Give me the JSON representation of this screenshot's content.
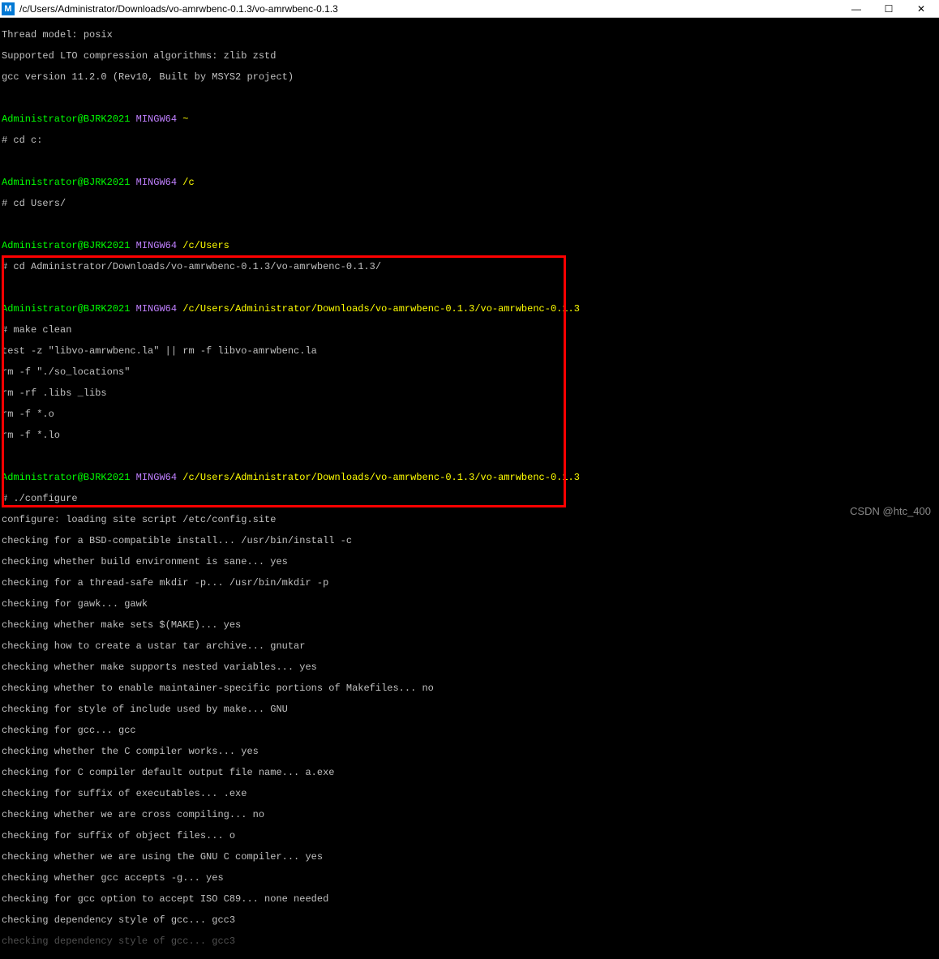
{
  "titlebar": {
    "icon_letter": "M",
    "path": "/c/Users/Administrator/Downloads/vo-amrwbenc-0.1.3/vo-amrwbenc-0.1.3",
    "min": "—",
    "max": "☐",
    "close": "✕"
  },
  "lines": {
    "l1": "Thread model: posix",
    "l2": "Supported LTO compression algorithms: zlib zstd",
    "l3": "gcc version 11.2.0 (Rev10, Built by MSYS2 project)",
    "l4": "",
    "p1_user": "Administrator@BJRK2021",
    "p1_env": "MINGW64",
    "p1_path": "~",
    "p1_cmd": "# cd c:",
    "p2_user": "Administrator@BJRK2021",
    "p2_env": "MINGW64",
    "p2_path": "/c",
    "p2_cmd": "# cd Users/",
    "p3_user": "Administrator@BJRK2021",
    "p3_env": "MINGW64",
    "p3_path": "/c/Users",
    "p3_cmd": "# cd Administrator/Downloads/vo-amrwbenc-0.1.3/vo-amrwbenc-0.1.3/",
    "p4_user": "Administrator@BJRK2021",
    "p4_env": "MINGW64",
    "p4_path": "/c/Users/Administrator/Downloads/vo-amrwbenc-0.1.3/vo-amrwbenc-0.1.3",
    "p4_cmd": "# make clean",
    "mk1": "test -z \"libvo-amrwbenc.la\" || rm -f libvo-amrwbenc.la",
    "mk2": "rm -f \"./so_locations\"",
    "mk3": "rm -rf .libs _libs",
    "mk4": "rm -f *.o",
    "mk5": "rm -f *.lo",
    "p5_user": "Administrator@BJRK2021",
    "p5_env": "MINGW64",
    "p5_path": "/c/Users/Administrator/Downloads/vo-amrwbenc-0.1.3/vo-amrwbenc-0.1.3",
    "p5_cmd": "# ./configure",
    "c1": "configure: loading site script /etc/config.site",
    "c2": "checking for a BSD-compatible install... /usr/bin/install -c",
    "c3": "checking whether build environment is sane... yes",
    "c4": "checking for a thread-safe mkdir -p... /usr/bin/mkdir -p",
    "c5": "checking for gawk... gawk",
    "c6": "checking whether make sets $(MAKE)... yes",
    "c7": "checking how to create a ustar tar archive... gnutar",
    "c8": "checking whether make supports nested variables... yes",
    "c9": "checking whether to enable maintainer-specific portions of Makefiles... no",
    "c10": "checking for style of include used by make... GNU",
    "c11": "checking for gcc... gcc",
    "c12": "checking whether the C compiler works... yes",
    "c13": "checking for C compiler default output file name... a.exe",
    "c14": "checking for suffix of executables... .exe",
    "c15": "checking whether we are cross compiling... no",
    "c16": "checking for suffix of object files... o",
    "c17": "checking whether we are using the GNU C compiler... yes",
    "c18": "checking whether gcc accepts -g... yes",
    "c19": "checking for gcc option to accept ISO C89... none needed",
    "c20": "checking dependency style of gcc... gcc3",
    "faded": "checking dependency style of gcc... gcc3"
  },
  "watermark": "CSDN @htc_400"
}
